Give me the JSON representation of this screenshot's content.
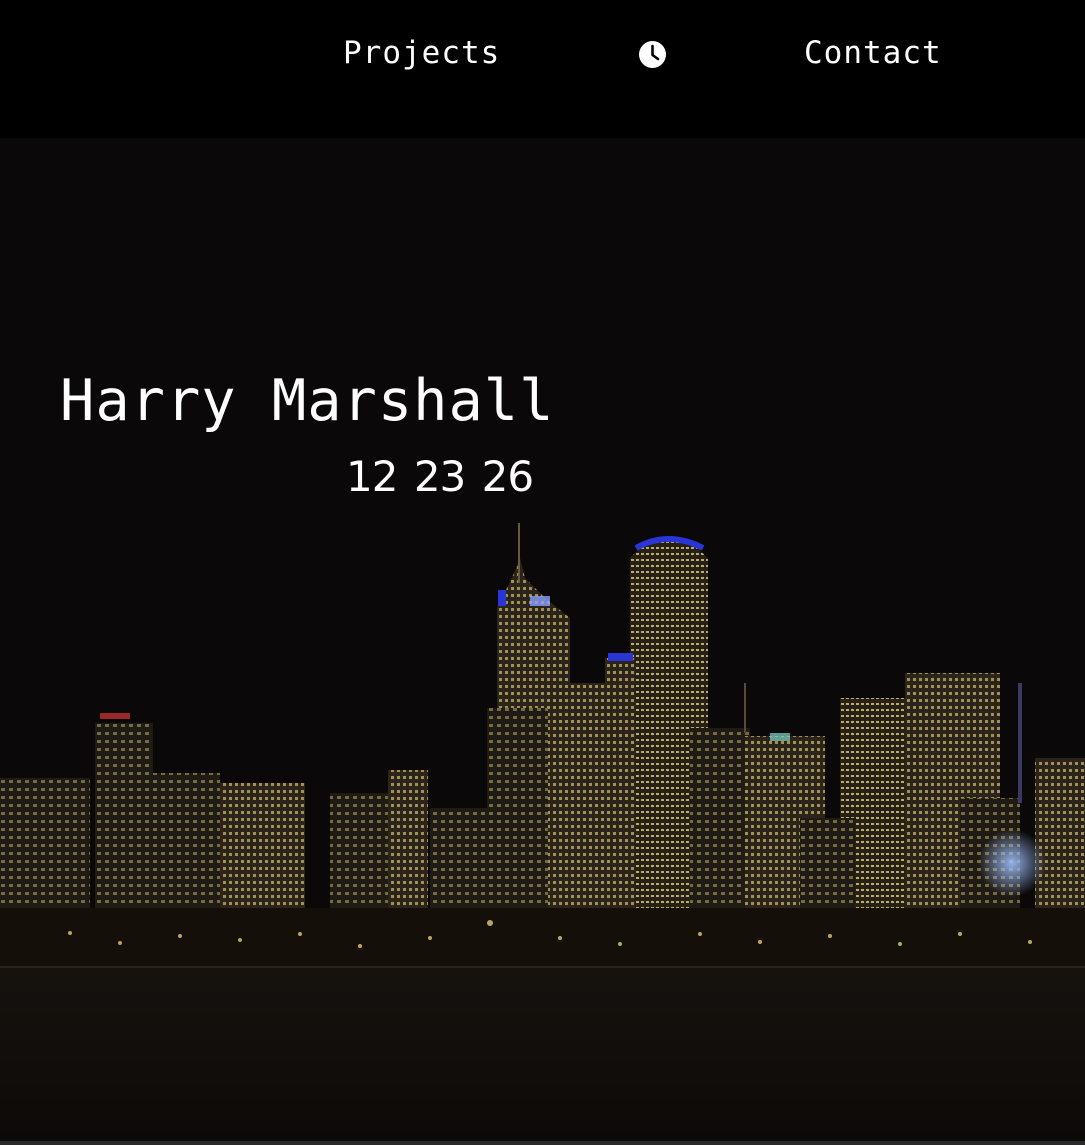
{
  "nav": {
    "projects_label": "Projects",
    "contact_label": "Contact",
    "clock_icon": "clock-icon"
  },
  "hero": {
    "name": "Harry Marshall",
    "countdown": {
      "hours": "12",
      "minutes": "23",
      "seconds": "26"
    },
    "background": "night-city-skyline-photo"
  },
  "colors": {
    "topbar": "#000000",
    "text": "#ffffff",
    "sky": "#0a0808",
    "window_light": "#d9c77a",
    "accent_blue": "#2a35d8"
  }
}
